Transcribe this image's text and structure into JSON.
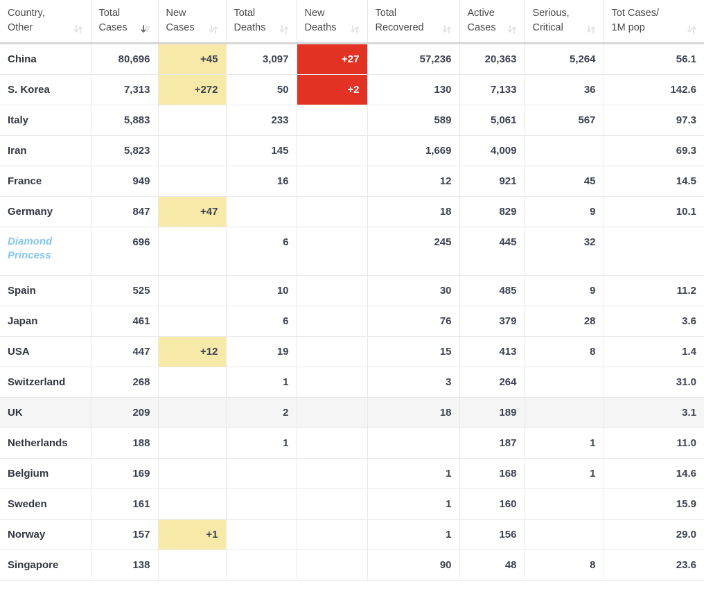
{
  "table": {
    "name": "coronavirus-cases-by-country",
    "sort": {
      "column": "Total Cases",
      "direction": "desc"
    },
    "colors": {
      "new_cases_highlight": "#f7e9a8",
      "new_deaths_highlight": "#e13224",
      "link_text": "#84c6ee",
      "row_hover": "#f5f5f5",
      "text": "#3c4250",
      "header_text": "#4a4a4a"
    },
    "columns": [
      {
        "key": "country",
        "line1": "Country,",
        "line2": "Other",
        "sort_icon": "sort-both-icon",
        "sorted": false
      },
      {
        "key": "total_cases",
        "line1": "Total",
        "line2": "Cases",
        "sort_icon": "sort-desc-icon",
        "sorted": true
      },
      {
        "key": "new_cases",
        "line1": "New",
        "line2": "Cases",
        "sort_icon": "sort-both-icon",
        "sorted": false
      },
      {
        "key": "total_deaths",
        "line1": "Total",
        "line2": "Deaths",
        "sort_icon": "sort-both-icon",
        "sorted": false
      },
      {
        "key": "new_deaths",
        "line1": "New",
        "line2": "Deaths",
        "sort_icon": "sort-both-icon",
        "sorted": false
      },
      {
        "key": "total_recovered",
        "line1": "Total",
        "line2": "Recovered",
        "sort_icon": "sort-both-icon",
        "sorted": false
      },
      {
        "key": "active_cases",
        "line1": "Active",
        "line2": "Cases",
        "sort_icon": "sort-both-icon",
        "sorted": false
      },
      {
        "key": "serious_critical",
        "line1": "Serious,",
        "line2": "Critical",
        "sort_icon": "sort-both-icon",
        "sorted": false
      },
      {
        "key": "cases_per_1m",
        "line1": "Tot Cases/",
        "line2": "1M pop",
        "sort_icon": "sort-both-icon",
        "sorted": false
      }
    ],
    "rows": [
      {
        "country": "China",
        "link": false,
        "hover": false,
        "total_cases": "80,696",
        "new_cases": "+45",
        "total_deaths": "3,097",
        "new_deaths": "+27",
        "total_recovered": "57,236",
        "active_cases": "20,363",
        "serious_critical": "5,264",
        "cases_per_1m": "56.1"
      },
      {
        "country": "S. Korea",
        "link": false,
        "hover": false,
        "total_cases": "7,313",
        "new_cases": "+272",
        "total_deaths": "50",
        "new_deaths": "+2",
        "total_recovered": "130",
        "active_cases": "7,133",
        "serious_critical": "36",
        "cases_per_1m": "142.6"
      },
      {
        "country": "Italy",
        "link": false,
        "hover": false,
        "total_cases": "5,883",
        "new_cases": "",
        "total_deaths": "233",
        "new_deaths": "",
        "total_recovered": "589",
        "active_cases": "5,061",
        "serious_critical": "567",
        "cases_per_1m": "97.3"
      },
      {
        "country": "Iran",
        "link": false,
        "hover": false,
        "total_cases": "5,823",
        "new_cases": "",
        "total_deaths": "145",
        "new_deaths": "",
        "total_recovered": "1,669",
        "active_cases": "4,009",
        "serious_critical": "",
        "cases_per_1m": "69.3"
      },
      {
        "country": "France",
        "link": false,
        "hover": false,
        "total_cases": "949",
        "new_cases": "",
        "total_deaths": "16",
        "new_deaths": "",
        "total_recovered": "12",
        "active_cases": "921",
        "serious_critical": "45",
        "cases_per_1m": "14.5"
      },
      {
        "country": "Germany",
        "link": false,
        "hover": false,
        "total_cases": "847",
        "new_cases": "+47",
        "total_deaths": "",
        "new_deaths": "",
        "total_recovered": "18",
        "active_cases": "829",
        "serious_critical": "9",
        "cases_per_1m": "10.1"
      },
      {
        "country": "Diamond Princess",
        "link": true,
        "hover": false,
        "tall": true,
        "total_cases": "696",
        "new_cases": "",
        "total_deaths": "6",
        "new_deaths": "",
        "total_recovered": "245",
        "active_cases": "445",
        "serious_critical": "32",
        "cases_per_1m": ""
      },
      {
        "country": "Spain",
        "link": false,
        "hover": false,
        "total_cases": "525",
        "new_cases": "",
        "total_deaths": "10",
        "new_deaths": "",
        "total_recovered": "30",
        "active_cases": "485",
        "serious_critical": "9",
        "cases_per_1m": "11.2"
      },
      {
        "country": "Japan",
        "link": false,
        "hover": false,
        "total_cases": "461",
        "new_cases": "",
        "total_deaths": "6",
        "new_deaths": "",
        "total_recovered": "76",
        "active_cases": "379",
        "serious_critical": "28",
        "cases_per_1m": "3.6"
      },
      {
        "country": "USA",
        "link": false,
        "hover": false,
        "total_cases": "447",
        "new_cases": "+12",
        "total_deaths": "19",
        "new_deaths": "",
        "total_recovered": "15",
        "active_cases": "413",
        "serious_critical": "8",
        "cases_per_1m": "1.4"
      },
      {
        "country": "Switzerland",
        "link": false,
        "hover": false,
        "total_cases": "268",
        "new_cases": "",
        "total_deaths": "1",
        "new_deaths": "",
        "total_recovered": "3",
        "active_cases": "264",
        "serious_critical": "",
        "cases_per_1m": "31.0"
      },
      {
        "country": "UK",
        "link": false,
        "hover": true,
        "total_cases": "209",
        "new_cases": "",
        "total_deaths": "2",
        "new_deaths": "",
        "total_recovered": "18",
        "active_cases": "189",
        "serious_critical": "",
        "cases_per_1m": "3.1"
      },
      {
        "country": "Netherlands",
        "link": false,
        "hover": false,
        "total_cases": "188",
        "new_cases": "",
        "total_deaths": "1",
        "new_deaths": "",
        "total_recovered": "",
        "active_cases": "187",
        "serious_critical": "1",
        "cases_per_1m": "11.0"
      },
      {
        "country": "Belgium",
        "link": false,
        "hover": false,
        "total_cases": "169",
        "new_cases": "",
        "total_deaths": "",
        "new_deaths": "",
        "total_recovered": "1",
        "active_cases": "168",
        "serious_critical": "1",
        "cases_per_1m": "14.6"
      },
      {
        "country": "Sweden",
        "link": false,
        "hover": false,
        "total_cases": "161",
        "new_cases": "",
        "total_deaths": "",
        "new_deaths": "",
        "total_recovered": "1",
        "active_cases": "160",
        "serious_critical": "",
        "cases_per_1m": "15.9"
      },
      {
        "country": "Norway",
        "link": false,
        "hover": false,
        "total_cases": "157",
        "new_cases": "+1",
        "total_deaths": "",
        "new_deaths": "",
        "total_recovered": "1",
        "active_cases": "156",
        "serious_critical": "",
        "cases_per_1m": "29.0"
      },
      {
        "country": "Singapore",
        "link": false,
        "hover": false,
        "total_cases": "138",
        "new_cases": "",
        "total_deaths": "",
        "new_deaths": "",
        "total_recovered": "90",
        "active_cases": "48",
        "serious_critical": "8",
        "cases_per_1m": "23.6"
      }
    ]
  }
}
